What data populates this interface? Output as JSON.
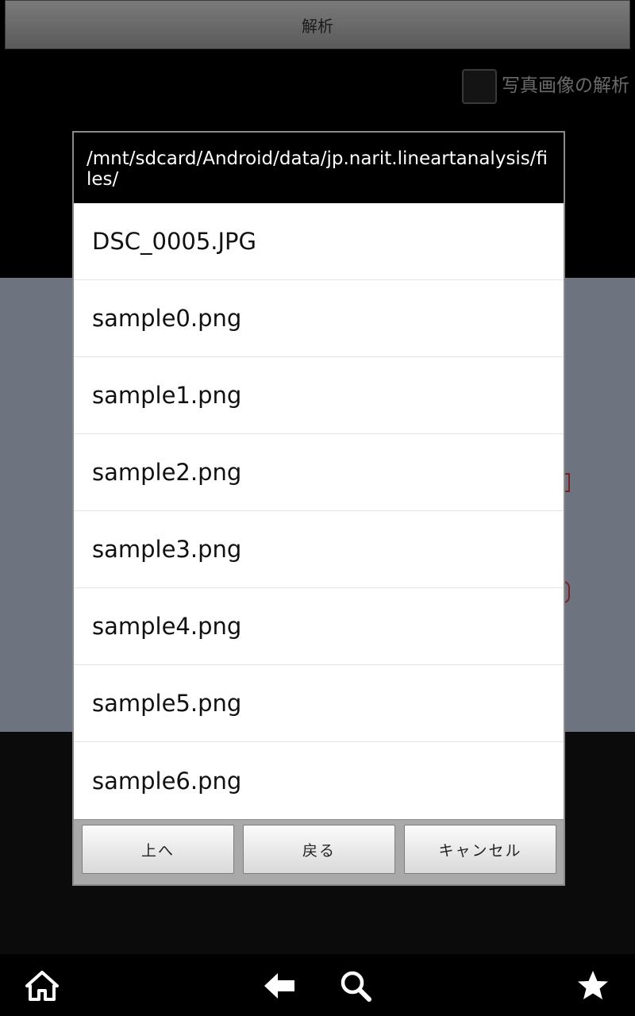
{
  "app": {
    "analyze_button": "解析",
    "photo_analysis_label": "写真画像の解析"
  },
  "dialog": {
    "path": "/mnt/sdcard/Android/data/jp.narit.lineartanalysis/files/",
    "files": [
      "DSC_0005.JPG",
      "sample0.png",
      "sample1.png",
      "sample2.png",
      "sample3.png",
      "sample4.png",
      "sample5.png",
      "sample6.png"
    ],
    "buttons": {
      "up": "上へ",
      "back": "戻る",
      "cancel": "キャンセル"
    }
  },
  "nav": {
    "icons": [
      "home-icon",
      "back-arrow-icon",
      "search-icon",
      "star-icon"
    ]
  },
  "colors": {
    "dialog_title_bg": "#000000",
    "list_bg": "#ffffff",
    "button_bar_bg": "#a9a9a9"
  }
}
